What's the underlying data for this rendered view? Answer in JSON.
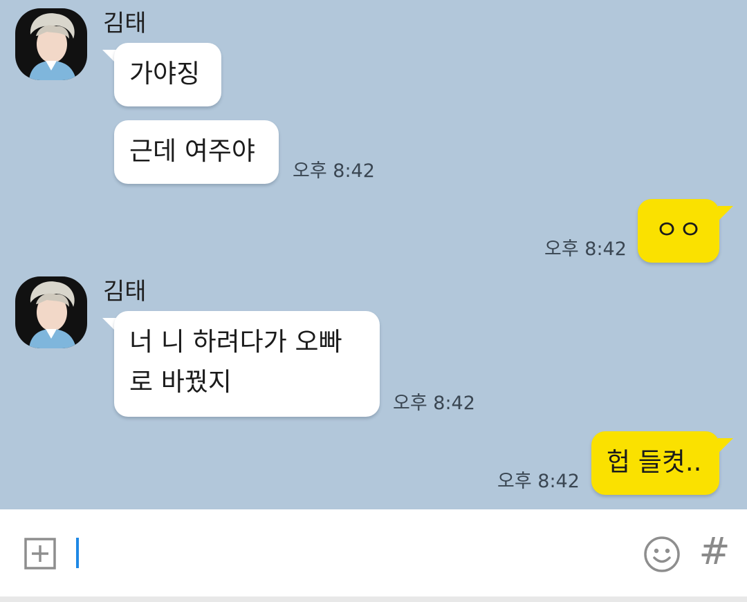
{
  "messages": [
    {
      "sender": "김태",
      "text": "가야징"
    },
    {
      "text": "근데 여주야",
      "time": "오후 8:42"
    },
    {
      "text": "ㅇㅇ",
      "time": "오후 8:42"
    },
    {
      "sender": "김태",
      "text_lines": [
        "너 니 하려다가 오빠",
        "로 바꿨지"
      ],
      "time": "오후 8:42"
    },
    {
      "text": "헙 들켯..",
      "time": "오후 8:42"
    }
  ],
  "colors": {
    "chat_background": "#b2c7da",
    "incoming_bubble": "#ffffff",
    "outgoing_bubble": "#fae100",
    "cursor": "#1e88e5"
  },
  "input_bar": {
    "value": "",
    "plus_icon": "plus-box-icon",
    "emoji_icon": "smiley-icon",
    "hash_label": "#"
  }
}
